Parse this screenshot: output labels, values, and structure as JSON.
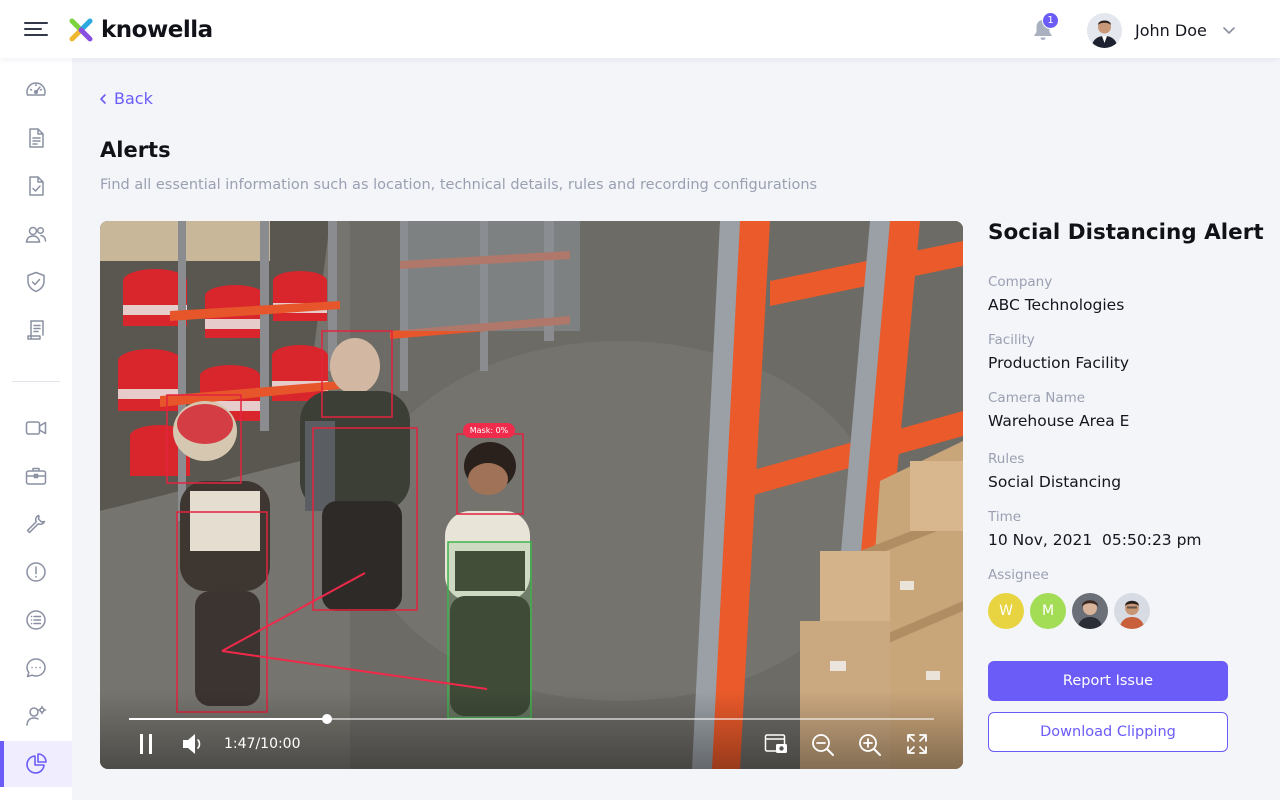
{
  "app": {
    "brand": "knowella",
    "notification_count": "1",
    "user_name": "John Doe"
  },
  "nav": {
    "items": [
      {
        "icon": "dashboard-icon"
      },
      {
        "icon": "document-icon"
      },
      {
        "icon": "checklist-icon"
      },
      {
        "icon": "users-icon"
      },
      {
        "icon": "shield-check-icon"
      },
      {
        "icon": "report-icon"
      },
      {
        "icon": "video-camera-icon"
      },
      {
        "icon": "briefcase-icon"
      },
      {
        "icon": "wrench-icon"
      },
      {
        "icon": "alert-circle-icon"
      },
      {
        "icon": "list-icon"
      },
      {
        "icon": "chat-icon"
      },
      {
        "icon": "user-settings-icon"
      },
      {
        "icon": "pie-chart-icon",
        "active": true
      }
    ]
  },
  "page": {
    "back_label": "Back",
    "title": "Alerts",
    "subtitle": "Find all essential information such as location, technical details, rules and recording configurations"
  },
  "video": {
    "mask_label": "Mask: 0%",
    "time_label": "1:47/10:00",
    "progress_fraction": 0.246
  },
  "alert": {
    "title": "Social Distancing Alert",
    "fields": [
      {
        "label": "Company",
        "value": "ABC Technologies"
      },
      {
        "label": "Facility",
        "value": "Production Facility"
      },
      {
        "label": "Camera Name",
        "value": "Warehouse Area E"
      },
      {
        "label": "Rules",
        "value": "Social Distancing"
      },
      {
        "label": "Time",
        "value": "10 Nov, 2021  05:50:23 pm"
      }
    ],
    "assignee_label": "Assignee",
    "assignees": [
      {
        "initial": "W",
        "color": "#e8d440"
      },
      {
        "initial": "M",
        "color": "#a3dc55"
      },
      {
        "initial": "",
        "color": "#6b6f78"
      },
      {
        "initial": "",
        "color": "#d7dbe4"
      }
    ],
    "report_label": "Report Issue",
    "download_label": "Download Clipping"
  },
  "colors": {
    "accent": "#6b5cf7",
    "alert_box": "#e3233f",
    "safe_box": "#3fb34a"
  }
}
